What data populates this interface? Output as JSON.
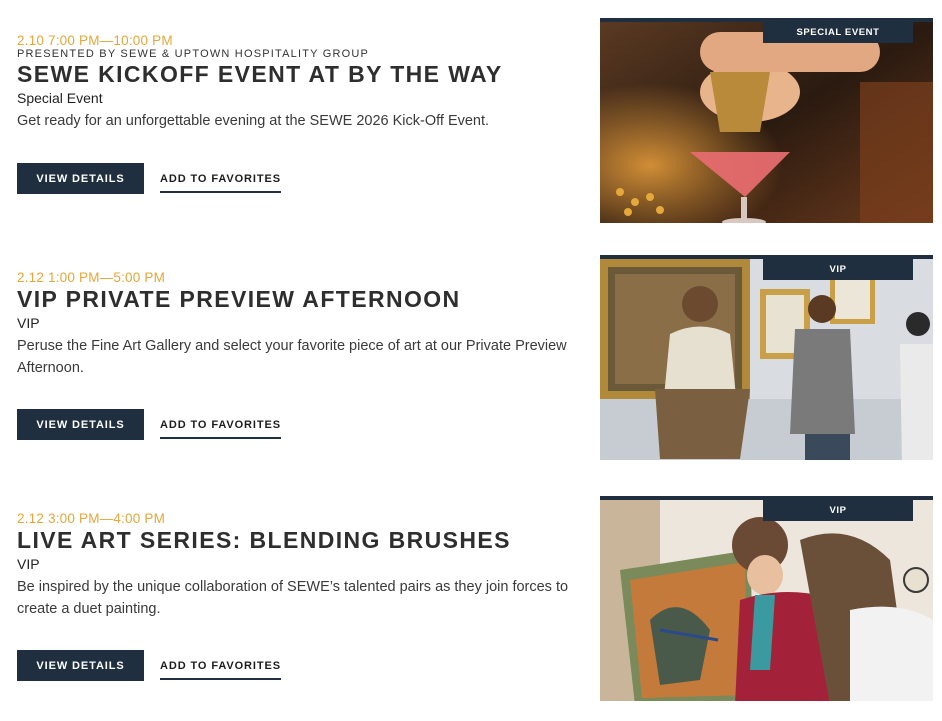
{
  "events": [
    {
      "date": "2.10 7:00 PM—10:00 PM",
      "presenter": "PRESENTED BY SEWE & UPTOWN HOSPITALITY GROUP",
      "title": "SEWE KICKOFF EVENT AT BY THE WAY",
      "category": "Special Event",
      "description": "Get ready for an unforgettable evening at the SEWE 2026 Kick-Off Event.",
      "badge": "SPECIAL EVENT",
      "details_label": "VIEW DETAILS",
      "favorite_label": "ADD TO FAVORITES"
    },
    {
      "date": "2.12 1:00 PM—5:00 PM",
      "title": "VIP PRIVATE PREVIEW AFTERNOON",
      "category": "VIP",
      "description": "Peruse the Fine Art Gallery and select your favorite piece of art at our Private Preview Afternoon.",
      "badge": "VIP",
      "details_label": "VIEW DETAILS",
      "favorite_label": "ADD TO FAVORITES"
    },
    {
      "date": "2.12 3:00 PM—4:00 PM",
      "title": "LIVE ART SERIES: BLENDING BRUSHES",
      "category": "VIP",
      "description": "Be inspired by the unique collaboration of SEWE’s talented pairs as they join forces to create a duet painting.",
      "badge": "VIP",
      "details_label": "VIEW DETAILS",
      "favorite_label": "ADD TO FAVORITES"
    }
  ],
  "colors": {
    "accent_date": "#e3a73a",
    "navy": "#1f2f40"
  }
}
